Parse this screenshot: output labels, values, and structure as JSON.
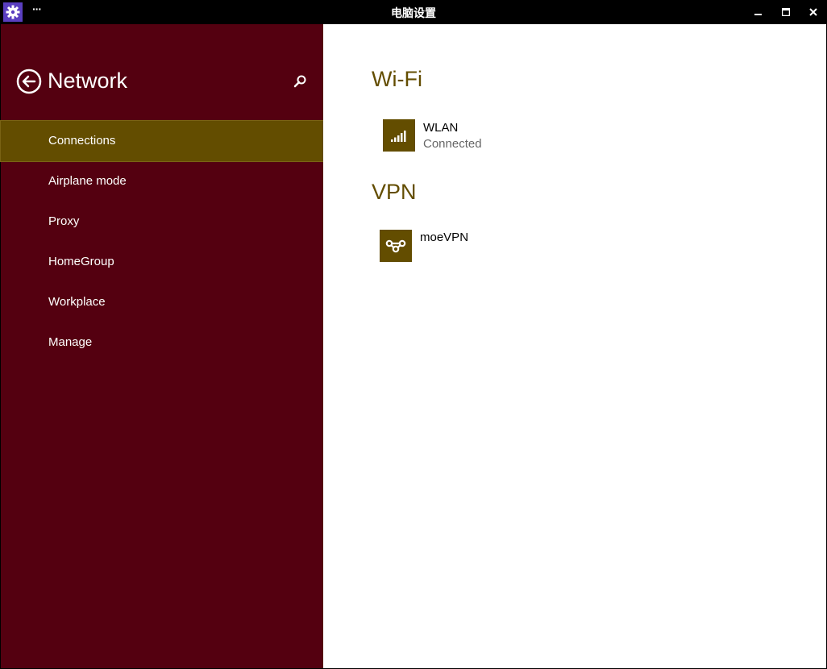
{
  "window": {
    "title": "电脑设置",
    "menu_label": "···"
  },
  "sidebar": {
    "title": "Network",
    "items": [
      {
        "label": "Connections",
        "active": true
      },
      {
        "label": "Airplane mode",
        "active": false
      },
      {
        "label": "Proxy",
        "active": false
      },
      {
        "label": "HomeGroup",
        "active": false
      },
      {
        "label": "Workplace",
        "active": false
      },
      {
        "label": "Manage",
        "active": false
      }
    ]
  },
  "content": {
    "wifi": {
      "heading": "Wi-Fi",
      "network": {
        "name": "WLAN",
        "status": "Connected",
        "icon": "wifi-signal-icon"
      }
    },
    "vpn": {
      "heading": "VPN",
      "connection": {
        "name": "moeVPN",
        "icon": "vpn-icon"
      }
    }
  },
  "colors": {
    "sidebar_bg": "#540010",
    "accent": "#634d00",
    "app_icon": "#5a3fc0"
  }
}
